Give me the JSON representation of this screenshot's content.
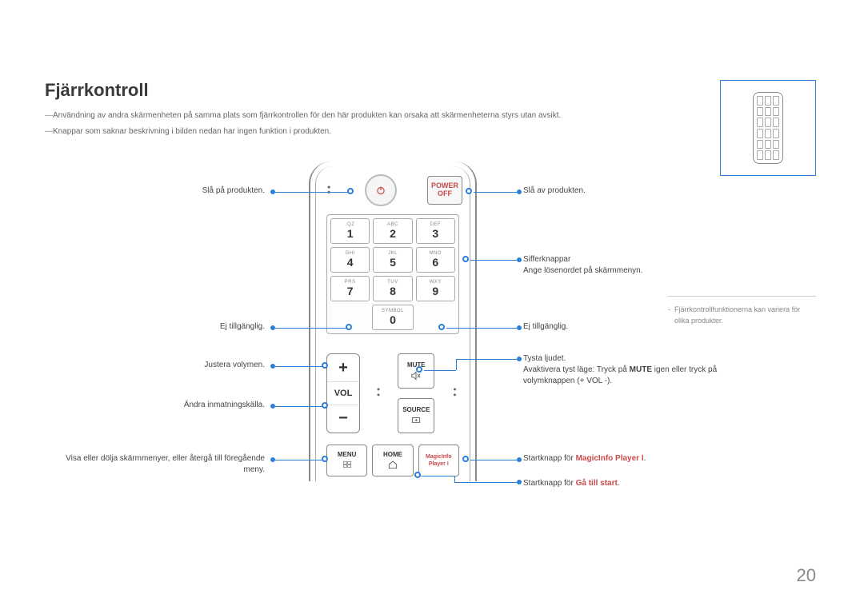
{
  "title": "Fjärrkontroll",
  "notes": [
    "Användning av andra skärmenheten på samma plats som fjärrkontrollen för den här produkten kan orsaka att skärmenheterna styrs utan avsikt.",
    "Knappar som saknar beskrivning i bilden nedan har ingen funktion i produkten."
  ],
  "remote": {
    "power_off": {
      "l1": "POWER",
      "l2": "OFF"
    },
    "keys": [
      [
        {
          "sub": ".QZ",
          "num": "1"
        },
        {
          "sub": "ABC",
          "num": "2"
        },
        {
          "sub": "DEF",
          "num": "3"
        }
      ],
      [
        {
          "sub": "GHI",
          "num": "4"
        },
        {
          "sub": "JKL",
          "num": "5"
        },
        {
          "sub": "MNO",
          "num": "6"
        }
      ],
      [
        {
          "sub": "PRS",
          "num": "7"
        },
        {
          "sub": "TUV",
          "num": "8"
        },
        {
          "sub": "WXY",
          "num": "9"
        }
      ]
    ],
    "zero": {
      "sub": "SYMBOL",
      "num": "0"
    },
    "vol": {
      "plus": "+",
      "label": "VOL",
      "minus": "−"
    },
    "mute": "MUTE",
    "source": "SOURCE",
    "menu": "MENU",
    "home": "HOME",
    "magic": {
      "l1": "MagicInfo",
      "l2": "Player I"
    }
  },
  "labels": {
    "left": {
      "power_on": "Slå på produkten.",
      "na1": "Ej tillgänglig.",
      "vol": "Justera volymen.",
      "source": "Ändra inmatningskälla.",
      "menu": "Visa eller dölja skärmmenyer, eller återgå till föregående meny."
    },
    "right": {
      "power_off": "Slå av produkten.",
      "digits_l1": "Sifferknappar",
      "digits_l2": "Ange lösenordet på skärmmenyn.",
      "na2": "Ej tillgänglig.",
      "mute_l1": "Tysta ljudet.",
      "mute_l2a": "Avaktivera tyst läge: Tryck på ",
      "mute_l2b": "MUTE",
      "mute_l2c": " igen eller tryck på volymknappen (+ VOL -).",
      "magic_a": "Startknapp för ",
      "magic_b": "MagicInfo Player I",
      "home_a": "Startknapp för ",
      "home_b": "Gå till start"
    }
  },
  "sidenote": "Fjärrkontrollfunktionerna kan variera för olika produkter.",
  "pagenum": "20"
}
